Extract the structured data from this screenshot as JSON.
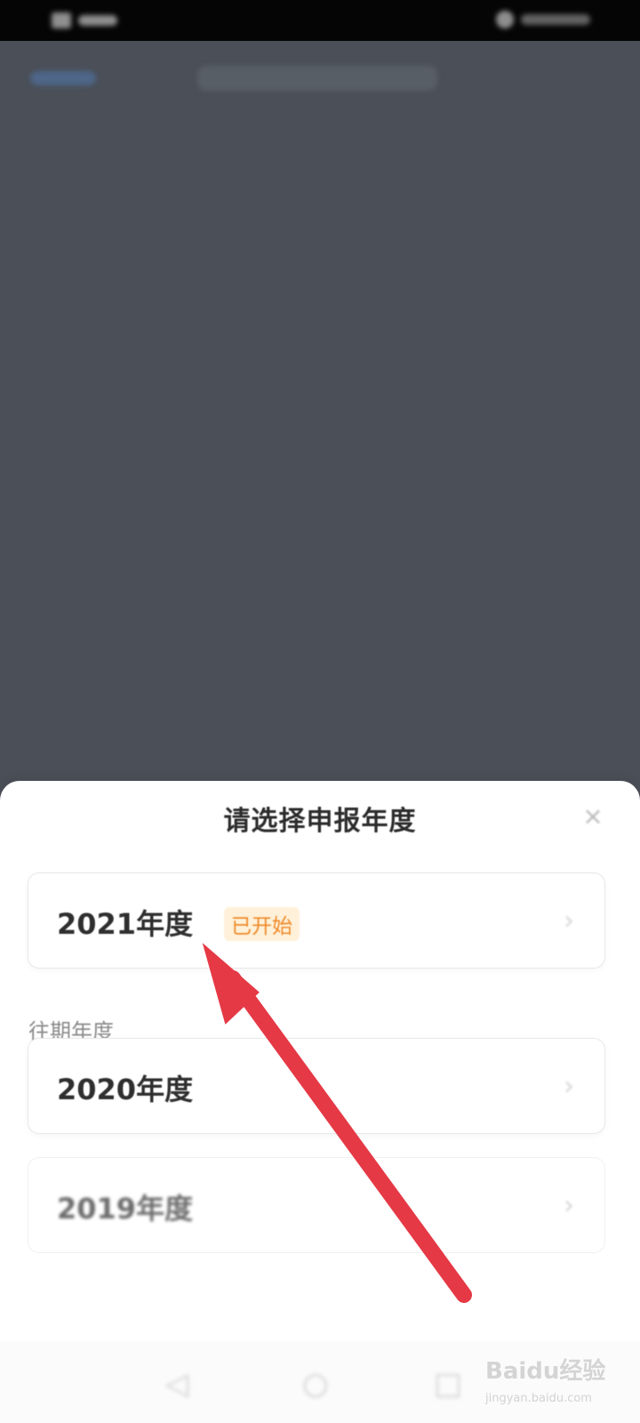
{
  "sheet": {
    "title": "请选择申报年度",
    "current": {
      "label": "2021年度",
      "badge": "已开始"
    },
    "past_section_label": "往期年度",
    "past": [
      {
        "label": "2020年度"
      },
      {
        "label": "2019年度"
      }
    ]
  },
  "watermark": {
    "brand": "Baidu经验",
    "url": "jingyan.baidu.com"
  },
  "icons": {
    "close": "close-icon",
    "chevron": "chevron-right-icon",
    "nav_back": "nav-back-icon",
    "nav_home": "nav-home-icon",
    "nav_recent": "nav-recent-icon"
  },
  "colors": {
    "badge_text": "#ef8a2a",
    "badge_bg": "#fff1d9",
    "annotation_arrow": "#e53945",
    "overlay": "#4a4f58"
  }
}
